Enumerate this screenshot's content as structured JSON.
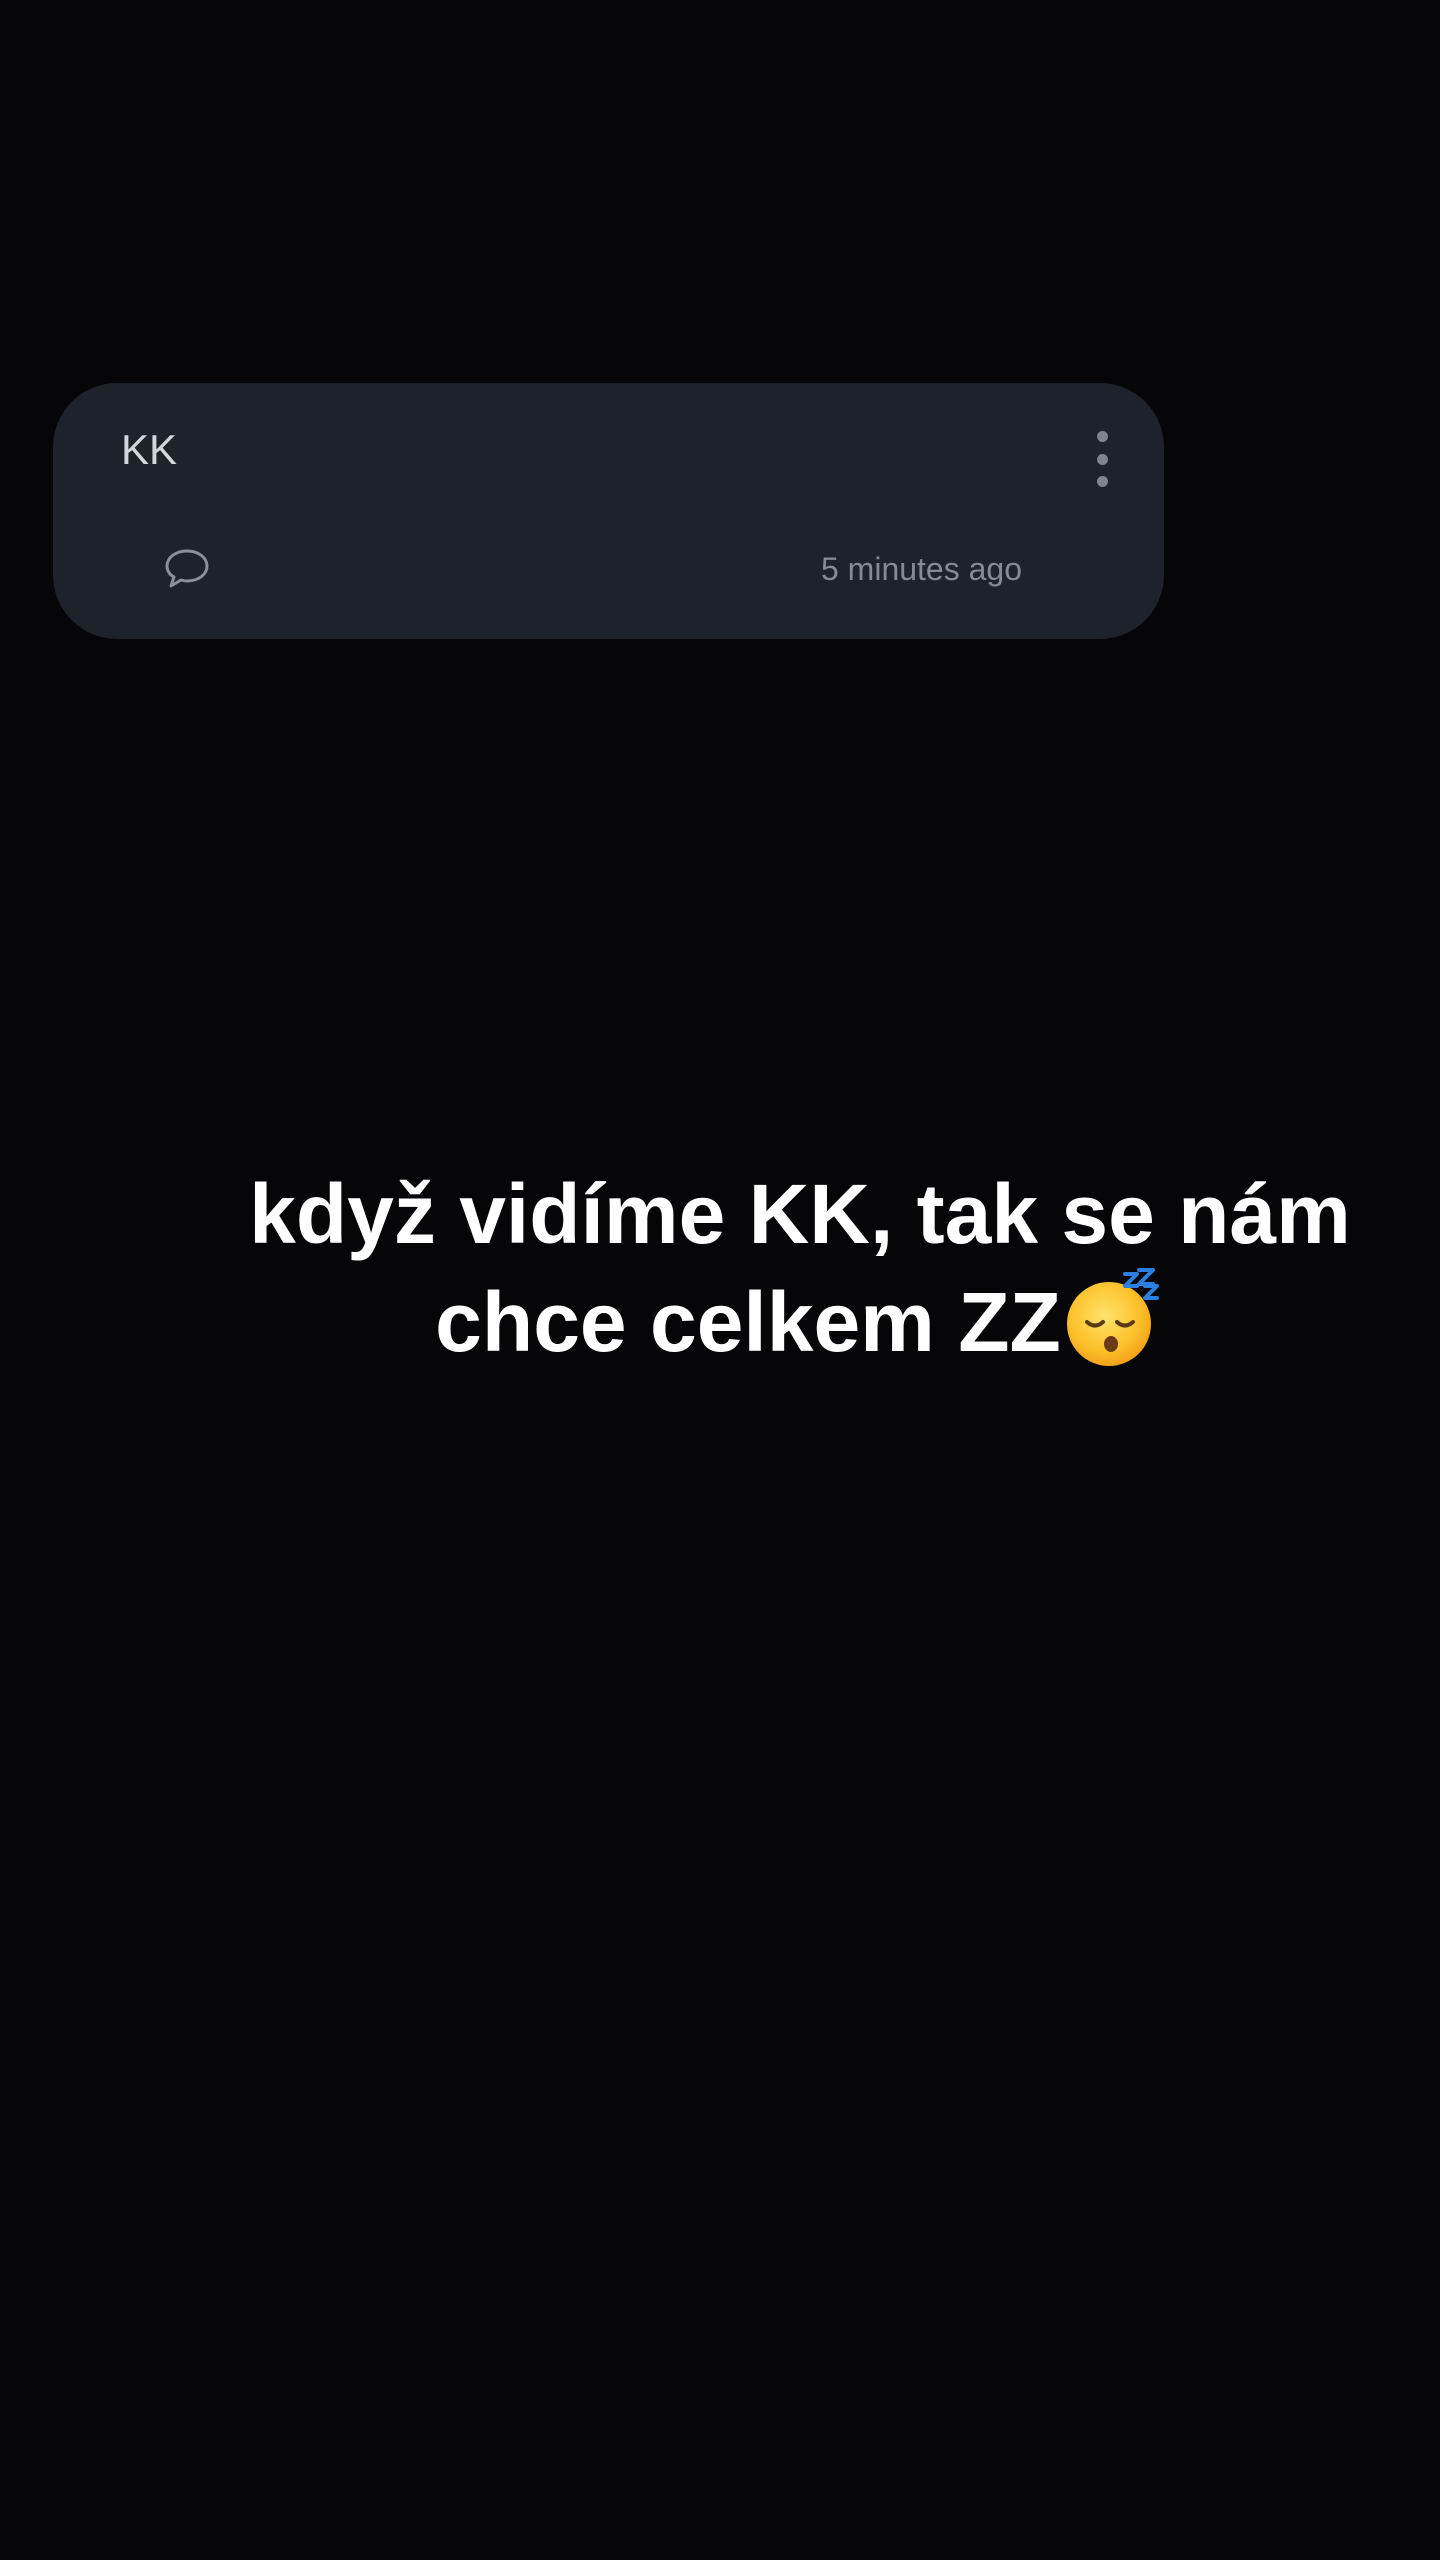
{
  "card": {
    "title": "KK",
    "timestamp": "5 minutes ago",
    "comment_icon": "speech-bubble-icon",
    "menu_icon": "more-vertical-icon"
  },
  "caption": {
    "line1": "když vidíme KK, tak se nám",
    "line2": "chce celkem ZZ",
    "emoji": "sleeping-face-emoji"
  },
  "colors": {
    "background": "#060608",
    "card": "#1d222b",
    "title_text": "#d3d7dc",
    "secondary_text": "#858b93",
    "caption_text": "#ffffff"
  }
}
